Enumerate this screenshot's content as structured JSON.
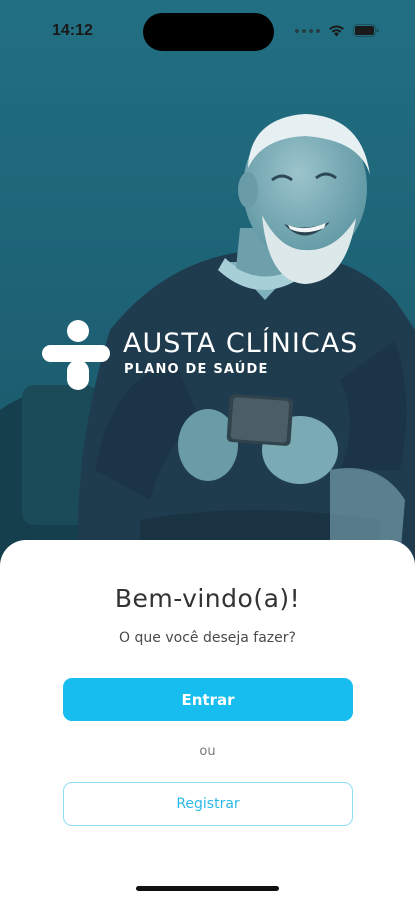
{
  "status_bar": {
    "time": "14:12"
  },
  "brand": {
    "name": "AUSTA CLÍNICAS",
    "tagline": "PLANO DE SAÚDE"
  },
  "welcome": {
    "title": "Bem-vindo(a)!",
    "subtitle": "O que você deseja fazer?"
  },
  "actions": {
    "login_label": "Entrar",
    "separator": "ou",
    "register_label": "Registrar"
  },
  "colors": {
    "primary": "#17bdee",
    "hero_tint": "#1b6174"
  }
}
